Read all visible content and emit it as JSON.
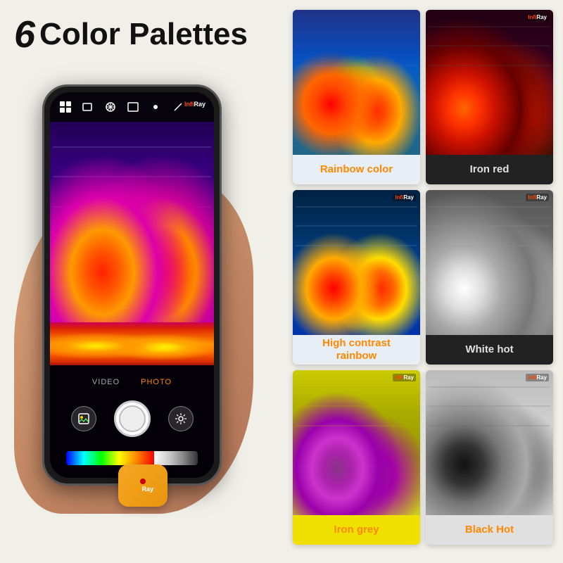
{
  "title": {
    "number": "6",
    "text": "Color Palettes"
  },
  "phone": {
    "mode_tabs": [
      "VIDEO",
      "PHOTO"
    ],
    "active_tab": "PHOTO",
    "brand": "InfiRay"
  },
  "device": {
    "brand_top": "Infi",
    "brand_bottom": "Ray"
  },
  "palettes": [
    {
      "id": "rainbow-color",
      "name": "Rainbow color",
      "name_color": "#ff8800",
      "bg_color": "#ccd8ee"
    },
    {
      "id": "iron-red",
      "name": "Iron red",
      "name_color": "#ff8800",
      "bg_color": "#2a1a1a"
    },
    {
      "id": "high-contrast-rainbow",
      "name": "High contrast\nrainbow",
      "name_color": "#ff8800",
      "bg_color": "#d0dde8"
    },
    {
      "id": "white-hot",
      "name": "White hot",
      "name_color": "#ff8800",
      "bg_color": "#2a2a2a"
    },
    {
      "id": "iron-grey",
      "name": "Iron grey",
      "name_color": "#ff8800",
      "bg_color": "#e8e000"
    },
    {
      "id": "black-hot",
      "name": "Black Hot",
      "name_color": "#ff8800",
      "bg_color": "#cccccc"
    }
  ],
  "icons": {
    "grid": "⊞",
    "square": "▢",
    "snowflake": "✳",
    "rect": "▭",
    "dot": "●",
    "pen": "/"
  }
}
